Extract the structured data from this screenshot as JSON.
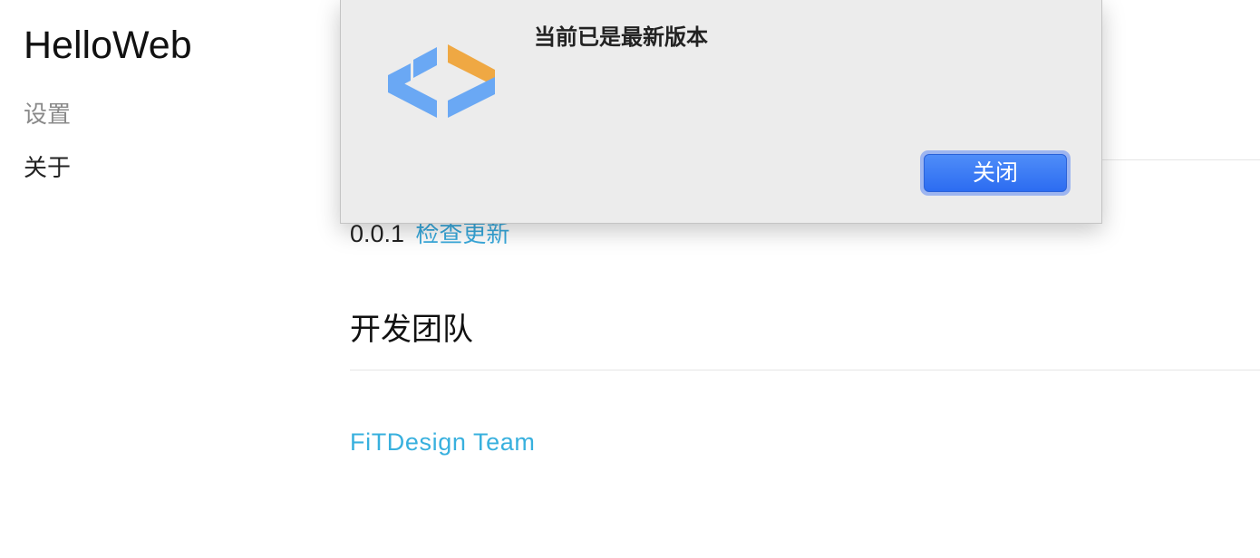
{
  "sidebar": {
    "app_title": "HelloWeb",
    "items": [
      {
        "label": "设置"
      },
      {
        "label": "关于"
      }
    ]
  },
  "main": {
    "version": "0.0.1",
    "check_update_label": "检查更新",
    "team_section_title": "开发团队",
    "team_name": "FiTDesign Team"
  },
  "dialog": {
    "icon": "app-logo-icon",
    "message": "当前已是最新版本",
    "close_label": "关闭"
  },
  "colors": {
    "link": "#38a9dc",
    "logo_blue": "#6aa8f4",
    "logo_orange": "#efa843",
    "button_blue": "#2c6cf1",
    "dialog_bg": "#ececec"
  }
}
